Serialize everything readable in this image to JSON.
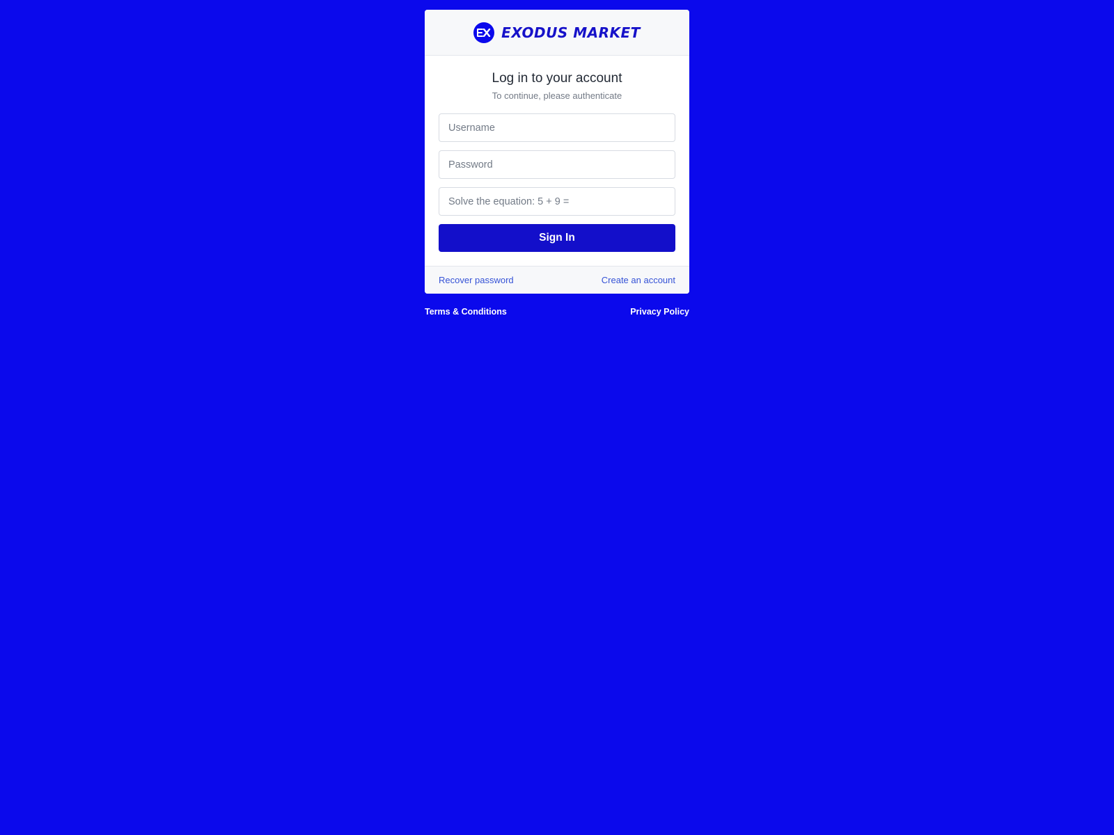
{
  "brand": {
    "name": "EXODUS MARKET",
    "logo_text": "EX",
    "logo_icon": "exodus-logo-icon"
  },
  "login": {
    "title": "Log in to your account",
    "subtitle": "To continue, please authenticate",
    "username": {
      "value": "",
      "placeholder": "Username"
    },
    "password": {
      "value": "",
      "placeholder": "Password"
    },
    "captcha": {
      "value": "",
      "placeholder": "Solve the equation: 5 + 9 ="
    },
    "submit_label": "Sign In"
  },
  "footer": {
    "recover_label": "Recover password",
    "create_label": "Create an account"
  },
  "legal": {
    "terms_label": "Terms & Conditions",
    "privacy_label": "Privacy Policy"
  },
  "colors": {
    "background": "#0b09ec",
    "brand": "#1611c9",
    "button": "#130fca",
    "link": "#3552d6"
  }
}
